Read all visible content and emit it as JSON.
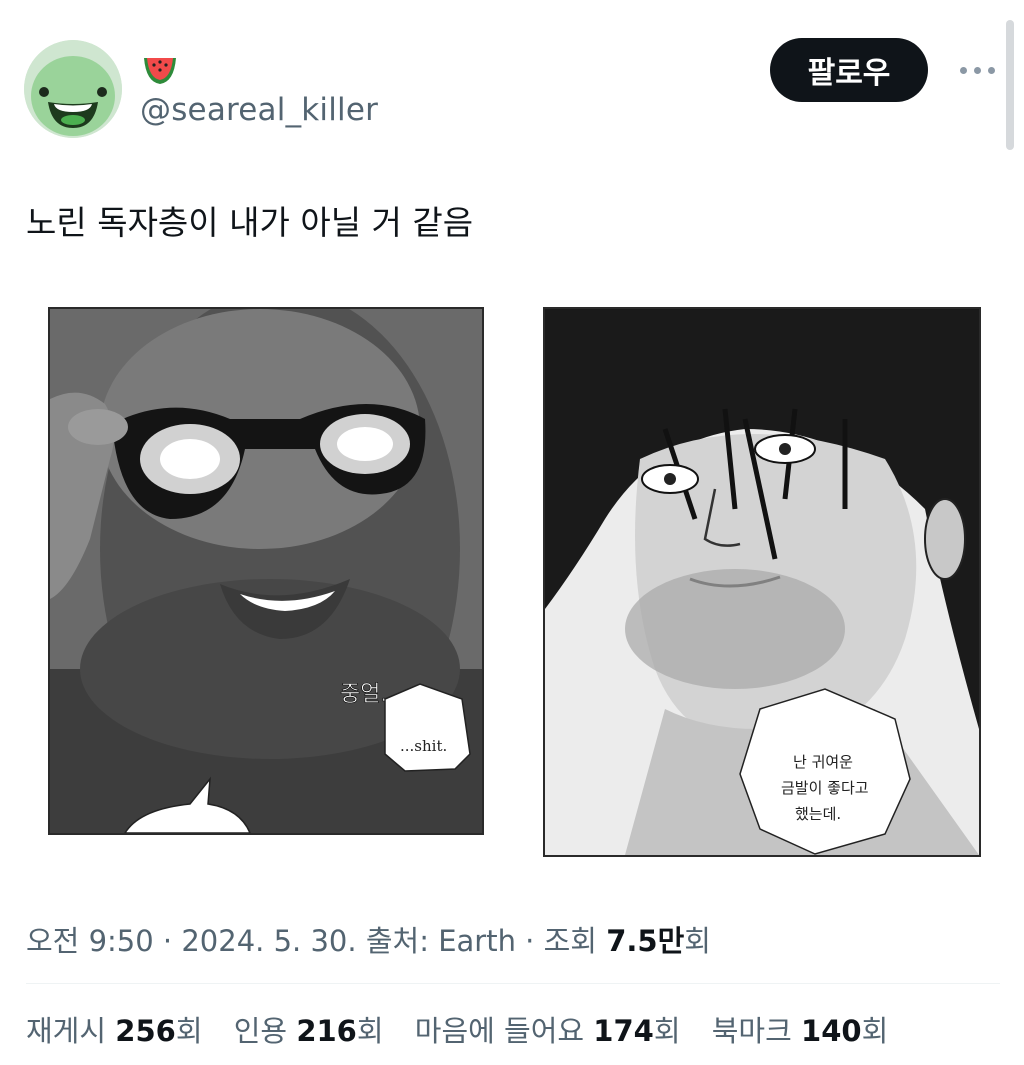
{
  "profile": {
    "name_emoji": "🍉",
    "handle": "@seareal_killer"
  },
  "actions": {
    "follow_label": "팔로우"
  },
  "tweet": {
    "text": "노린 독자층이 내가 아닐 거 같음",
    "images": [
      {
        "bubble_texts": [
          "중얼..",
          "...shit."
        ]
      },
      {
        "bubble_lines": [
          "난 귀여운",
          "금발이 좋다고",
          "했는데."
        ]
      }
    ]
  },
  "meta": {
    "time": "오전 9:50",
    "sep1": " · ",
    "date": "2024. 5. 30.",
    "sep2": " ",
    "source_label": "출처:",
    "source_value": "Earth",
    "sep3": " · ",
    "views_label": "조회 ",
    "views_value": "7.5만",
    "views_suffix": "회"
  },
  "stats": {
    "reposts_label": "재게시 ",
    "reposts_value": "256",
    "reposts_suffix": "회",
    "quotes_label": "인용 ",
    "quotes_value": "216",
    "quotes_suffix": "회",
    "likes_label": "마음에 들어요 ",
    "likes_value": "174",
    "likes_suffix": "회",
    "bookmarks_label": "북마크 ",
    "bookmarks_value": "140",
    "bookmarks_suffix": "회"
  },
  "colors": {
    "text_primary": "#0f1419",
    "text_secondary": "#536471",
    "button_bg": "#0f1419",
    "button_text": "#ffffff",
    "avatar_bg": "#cfe6d0",
    "avatar_face": "#8fd28f"
  },
  "icons": {
    "more": "more-horizontal-icon",
    "name_emoji": "watermelon-icon"
  }
}
